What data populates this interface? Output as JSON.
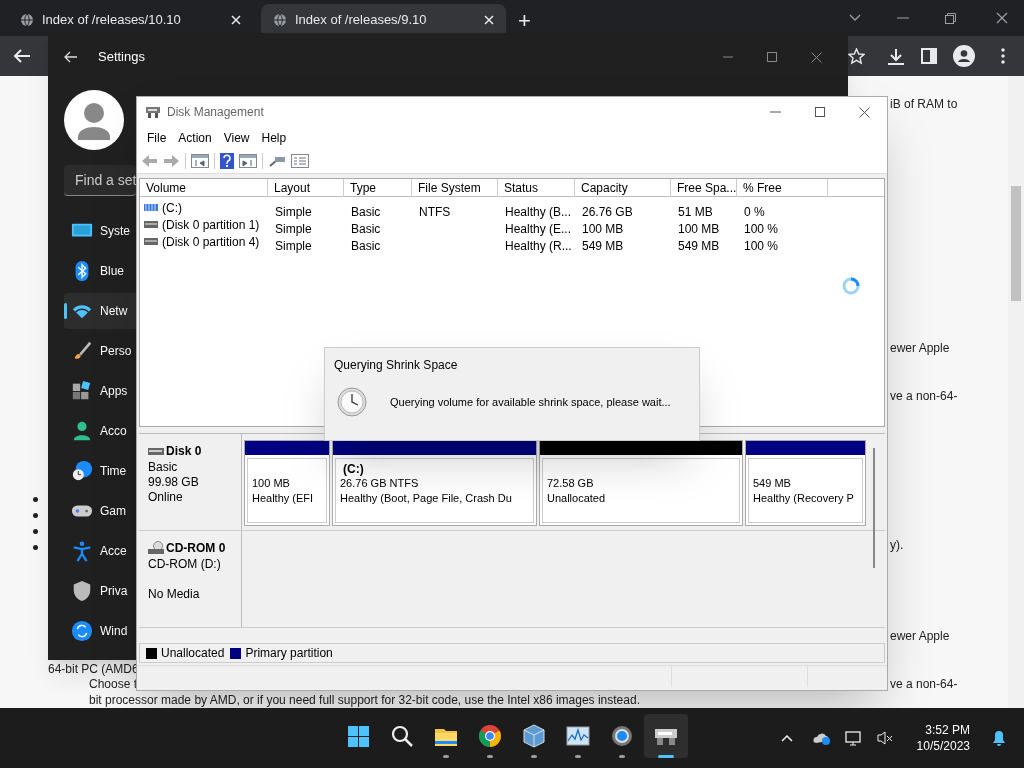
{
  "browser": {
    "tabs": [
      {
        "title": "Index of /releases/10.10",
        "selected": false
      },
      {
        "title": "Index of /releases/9.10",
        "selected": true
      }
    ],
    "new_tab": "+",
    "page_fragments": [
      "iB of RAM to",
      "ewer Apple",
      "ve a non-64-",
      "y).",
      "ewer Apple",
      "ve a non-64-",
      "64-bit PC (AMD6",
      "Choose t",
      "bit processor made by AMD, or if you need full support for 32-bit code, use the Intel x86 images instead."
    ]
  },
  "settings": {
    "title": "Settings",
    "search": {
      "placeholder": "Find a set"
    },
    "nav": [
      {
        "label": "Syste",
        "selected": false
      },
      {
        "label": "Blue",
        "selected": false
      },
      {
        "label": "Netw",
        "selected": true
      },
      {
        "label": "Perso",
        "selected": false
      },
      {
        "label": "Apps",
        "selected": false
      },
      {
        "label": "Acco",
        "selected": false
      },
      {
        "label": "Time",
        "selected": false
      },
      {
        "label": "Gam",
        "selected": false
      },
      {
        "label": "Acce",
        "selected": false
      },
      {
        "label": "Priva",
        "selected": false
      },
      {
        "label": "Wind",
        "selected": false
      }
    ]
  },
  "disk_management": {
    "title": "Disk Management",
    "menu": [
      "File",
      "Action",
      "View",
      "Help"
    ],
    "columns": [
      "Volume",
      "Layout",
      "Type",
      "File System",
      "Status",
      "Capacity",
      "Free Spa...",
      "% Free"
    ],
    "rows": [
      {
        "kind": "striped",
        "cells": [
          "(C:)",
          "Simple",
          "Basic",
          "NTFS",
          "Healthy (B...",
          "26.76 GB",
          "51 MB",
          "0 %"
        ]
      },
      {
        "kind": "plain",
        "cells": [
          "(Disk 0 partition 1)",
          "Simple",
          "Basic",
          "",
          "Healthy (E...",
          "100 MB",
          "100 MB",
          "100 %"
        ]
      },
      {
        "kind": "plain",
        "cells": [
          "(Disk 0 partition 4)",
          "Simple",
          "Basic",
          "",
          "Healthy (R...",
          "549 MB",
          "549 MB",
          "100 %"
        ]
      }
    ],
    "disks": [
      {
        "kind": "disk",
        "name": "Disk 0",
        "lines": [
          "Basic",
          "99.98 GB",
          "Online"
        ],
        "partitions": [
          {
            "kind": "primary",
            "size": "100 MB",
            "status": "Healthy (EFI"
          },
          {
            "kind": "primary",
            "label": "(C:)",
            "size": "26.76 GB NTFS",
            "status": "Healthy (Boot, Page File, Crash Du"
          },
          {
            "kind": "unallocated",
            "size": "72.58 GB",
            "status": "Unallocated"
          },
          {
            "kind": "primary",
            "size": "549 MB",
            "status": "Healthy (Recovery P"
          }
        ]
      },
      {
        "kind": "cdrom",
        "name": "CD-ROM 0",
        "lines": [
          "CD-ROM (D:)",
          "No Media"
        ]
      }
    ],
    "legend": [
      {
        "label": "Unallocated",
        "color": "#000000"
      },
      {
        "label": "Primary partition",
        "color": "#000080"
      }
    ]
  },
  "dialog": {
    "title": "Querying Shrink Space",
    "message": "Querying volume for available shrink space, please wait..."
  },
  "taskbar": {
    "time": "3:52 PM",
    "date": "10/5/2023"
  }
}
